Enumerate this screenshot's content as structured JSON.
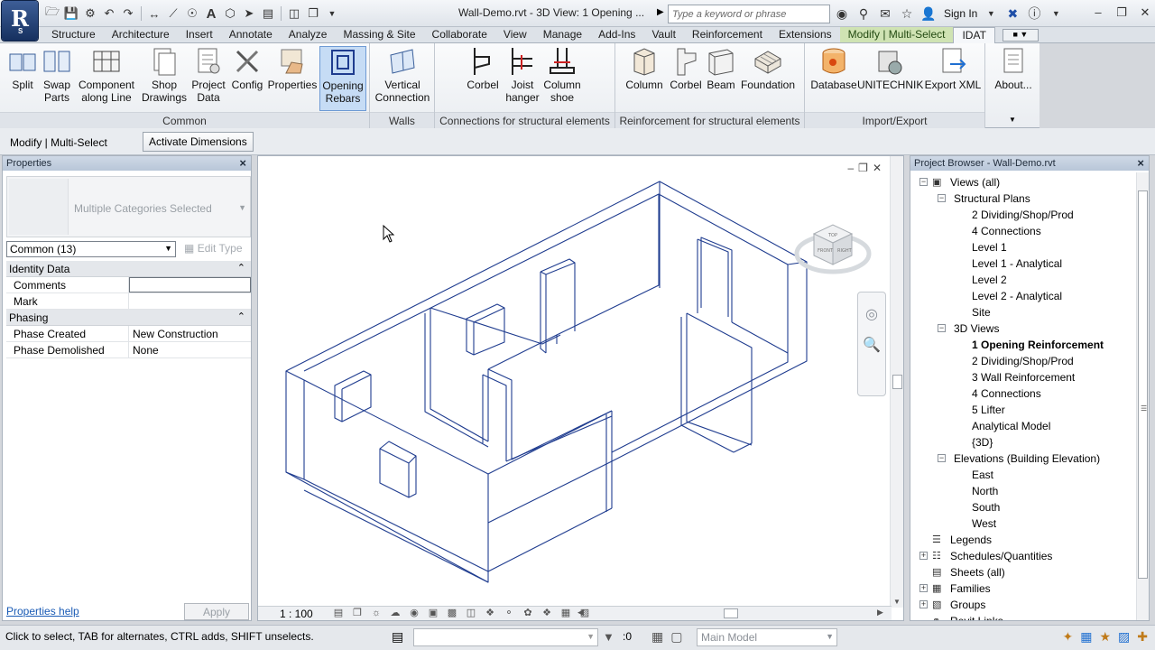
{
  "app": {
    "logo_letter": "R",
    "logo_sub": "S",
    "document_title": "Wall-Demo.rvt - 3D View: 1 Opening ...",
    "search_placeholder": "Type a keyword or phrase",
    "sign_in": "Sign In"
  },
  "tabs": [
    {
      "label": "Structure"
    },
    {
      "label": "Architecture"
    },
    {
      "label": "Insert"
    },
    {
      "label": "Annotate"
    },
    {
      "label": "Analyze"
    },
    {
      "label": "Massing & Site"
    },
    {
      "label": "Collaborate"
    },
    {
      "label": "View"
    },
    {
      "label": "Manage"
    },
    {
      "label": "Add-Ins"
    },
    {
      "label": "Vault"
    },
    {
      "label": "Reinforcement"
    },
    {
      "label": "Extensions"
    },
    {
      "label": "Modify | Multi-Select"
    },
    {
      "label": "IDAT"
    }
  ],
  "ribbon": {
    "common": {
      "label": "Common",
      "buttons": [
        {
          "l1": "Split",
          "l2": ""
        },
        {
          "l1": "Swap",
          "l2": "Parts"
        },
        {
          "l1": "Component",
          "l2": "along Line"
        },
        {
          "l1": "Shop",
          "l2": "Drawings"
        },
        {
          "l1": "Project",
          "l2": "Data"
        },
        {
          "l1": "Config",
          "l2": ""
        },
        {
          "l1": "Properties",
          "l2": ""
        },
        {
          "l1": "Opening",
          "l2": "Rebars"
        }
      ]
    },
    "walls": {
      "label": "Walls",
      "buttons": [
        {
          "l1": "Vertical",
          "l2": "Connection"
        }
      ]
    },
    "connections": {
      "label": "Connections for structural elements",
      "buttons": [
        {
          "l1": "Corbel",
          "l2": ""
        },
        {
          "l1": "Joist",
          "l2": "hanger"
        },
        {
          "l1": "Column",
          "l2": "shoe"
        }
      ]
    },
    "reinforcement": {
      "label": "Reinforcement for structural elements",
      "buttons": [
        {
          "l1": "Column",
          "l2": ""
        },
        {
          "l1": "Corbel",
          "l2": ""
        },
        {
          "l1": "Beam",
          "l2": ""
        },
        {
          "l1": "Foundation",
          "l2": ""
        }
      ]
    },
    "importexport": {
      "label": "Import/Export",
      "buttons": [
        {
          "l1": "Database",
          "l2": ""
        },
        {
          "l1": "UNITECHNIK",
          "l2": ""
        },
        {
          "l1": "Export XML",
          "l2": ""
        }
      ]
    },
    "about": {
      "buttons": [
        {
          "l1": "About...",
          "l2": ""
        }
      ]
    }
  },
  "optionsbar": {
    "label": "Modify | Multi-Select",
    "activate_dimensions": "Activate Dimensions"
  },
  "properties": {
    "title": "Properties",
    "type_name": "Multiple Categories Selected",
    "filter": "Common (13)",
    "edit_type": "Edit Type",
    "groups": [
      {
        "name": "Identity Data",
        "rows": [
          {
            "key": "Comments",
            "value": ""
          },
          {
            "key": "Mark",
            "value": ""
          }
        ]
      },
      {
        "name": "Phasing",
        "rows": [
          {
            "key": "Phase Created",
            "value": "New Construction"
          },
          {
            "key": "Phase Demolished",
            "value": "None"
          }
        ]
      }
    ],
    "help_link": "Properties help",
    "apply": "Apply"
  },
  "viewport": {
    "scale": "1 : 100",
    "viewcube": {
      "top": "TOP",
      "front": "FRONT",
      "right": "RIGHT"
    }
  },
  "browser": {
    "title": "Project Browser - Wall-Demo.rvt",
    "items": [
      {
        "label": "Views (all)",
        "level": 0,
        "exp": "-",
        "icon": "views"
      },
      {
        "label": "Structural Plans",
        "level": 1,
        "exp": "-"
      },
      {
        "label": "2 Dividing/Shop/Prod",
        "level": 2
      },
      {
        "label": "4 Connections",
        "level": 2
      },
      {
        "label": "Level 1",
        "level": 2
      },
      {
        "label": "Level 1 - Analytical",
        "level": 2
      },
      {
        "label": "Level 2",
        "level": 2
      },
      {
        "label": "Level 2 - Analytical",
        "level": 2
      },
      {
        "label": "Site",
        "level": 2
      },
      {
        "label": "3D Views",
        "level": 1,
        "exp": "-"
      },
      {
        "label": "1 Opening Reinforcement",
        "level": 2,
        "bold": true
      },
      {
        "label": "2 Dividing/Shop/Prod",
        "level": 2
      },
      {
        "label": "3 Wall Reinforcement",
        "level": 2
      },
      {
        "label": "4 Connections",
        "level": 2
      },
      {
        "label": "5 Lifter",
        "level": 2
      },
      {
        "label": "Analytical Model",
        "level": 2
      },
      {
        "label": "{3D}",
        "level": 2
      },
      {
        "label": "Elevations (Building Elevation)",
        "level": 1,
        "exp": "-"
      },
      {
        "label": "East",
        "level": 2
      },
      {
        "label": "North",
        "level": 2
      },
      {
        "label": "South",
        "level": 2
      },
      {
        "label": "West",
        "level": 2
      },
      {
        "label": "Legends",
        "level": 0,
        "icon": "legends"
      },
      {
        "label": "Schedules/Quantities",
        "level": 0,
        "exp": "+",
        "icon": "schedules"
      },
      {
        "label": "Sheets (all)",
        "level": 0,
        "icon": "sheets"
      },
      {
        "label": "Families",
        "level": 0,
        "exp": "+",
        "icon": "families"
      },
      {
        "label": "Groups",
        "level": 0,
        "exp": "+",
        "icon": "groups"
      },
      {
        "label": "Revit Links",
        "level": 0,
        "icon": "links"
      }
    ]
  },
  "status": {
    "text": "Click to select, TAB for alternates, CTRL adds, SHIFT unselects.",
    "count": ":0",
    "model": "Main Model"
  },
  "colors": {
    "model_line": "#1f3c8f",
    "selected_button": "#c6dcf5",
    "context_tab": "#cfe3b3"
  }
}
